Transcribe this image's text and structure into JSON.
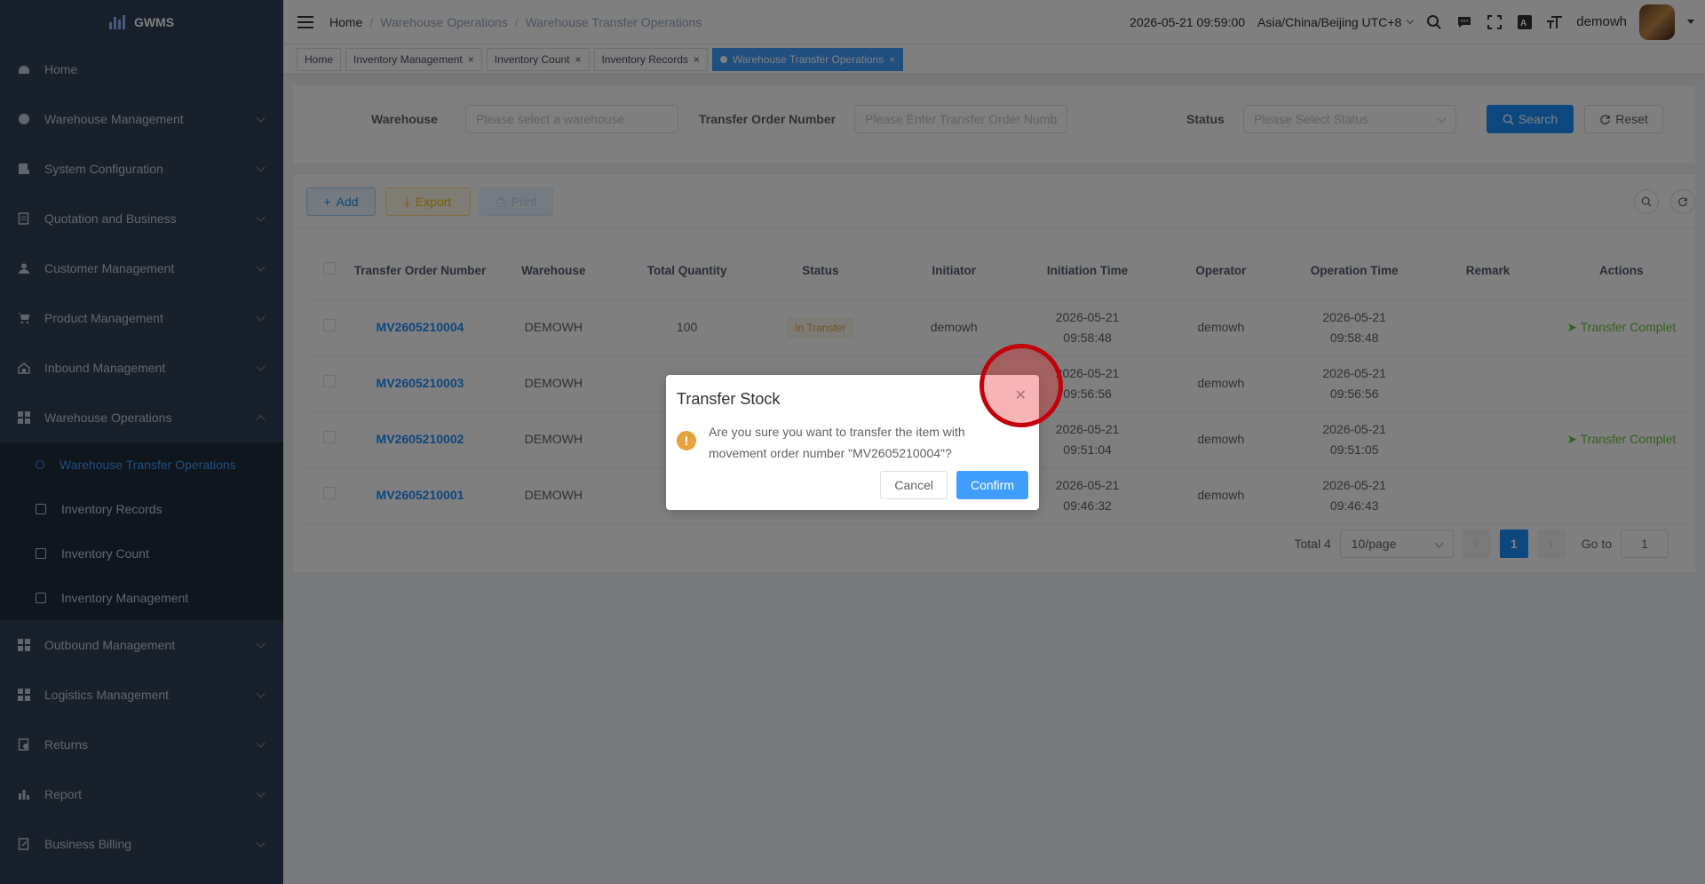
{
  "app": {
    "name": "GWMS"
  },
  "sidebar": {
    "items": [
      {
        "label": "Home",
        "icon": "dashboard-icon"
      },
      {
        "label": "Warehouse Management",
        "icon": "globe-icon"
      },
      {
        "label": "System Configuration",
        "icon": "config-icon"
      },
      {
        "label": "Quotation and Business",
        "icon": "document-icon"
      },
      {
        "label": "Customer Management",
        "icon": "user-icon"
      },
      {
        "label": "Product Management",
        "icon": "cart-icon"
      },
      {
        "label": "Inbound Management",
        "icon": "inbound-icon"
      },
      {
        "label": "Warehouse Operations",
        "icon": "grid-icon"
      }
    ],
    "sub_items": [
      {
        "label": "Warehouse Transfer Operations",
        "active": true
      },
      {
        "label": "Inventory Records"
      },
      {
        "label": "Inventory Count"
      },
      {
        "label": "Inventory Management"
      }
    ],
    "items_after": [
      {
        "label": "Outbound Management",
        "icon": "grid-icon"
      },
      {
        "label": "Logistics Management",
        "icon": "grid-icon"
      },
      {
        "label": "Returns",
        "icon": "returns-icon"
      },
      {
        "label": "Report",
        "icon": "chart-icon"
      },
      {
        "label": "Business Billing",
        "icon": "billing-icon"
      }
    ]
  },
  "navbar": {
    "breadcrumb": [
      "Home",
      "Warehouse Operations",
      "Warehouse Transfer Operations"
    ],
    "datetime": "2026-05-21 09:59:00",
    "timezone": "Asia/China/Beijing UTC+8",
    "username": "demowh"
  },
  "tags": [
    {
      "label": "Home"
    },
    {
      "label": "Inventory Management"
    },
    {
      "label": "Inventory Count"
    },
    {
      "label": "Inventory Records"
    },
    {
      "label": "Warehouse Transfer Operations",
      "active": true
    }
  ],
  "search": {
    "warehouse_label": "Warehouse",
    "warehouse_placeholder": "Please select a warehouse",
    "order_label": "Transfer Order Number",
    "order_placeholder": "Please Enter Transfer Order Numb",
    "status_label": "Status",
    "status_placeholder": "Please Select Status",
    "search_btn": "Search",
    "reset_btn": "Reset"
  },
  "toolbar": {
    "add": "Add",
    "export": "Export",
    "print": "Print"
  },
  "table": {
    "headers": [
      "Transfer Order Number",
      "Warehouse",
      "Total Quantity",
      "Status",
      "Initiator",
      "Initiation Time",
      "Operator",
      "Operation Time",
      "Remark",
      "Actions"
    ],
    "rows": [
      {
        "order": "MV2605210004",
        "warehouse": "DEMOWH",
        "qty": "100",
        "status": "In Transfer",
        "initiator": "demowh",
        "init_date": "2026-05-21",
        "init_time": "09:58:48",
        "operator": "demowh",
        "op_date": "2026-05-21",
        "op_time": "09:58:48",
        "remark": "",
        "action": "Transfer Complet"
      },
      {
        "order": "MV2605210003",
        "warehouse": "DEMOWH",
        "qty": "",
        "status": "",
        "initiator": "",
        "init_date": "2026-05-21",
        "init_time": "09:56:56",
        "operator": "demowh",
        "op_date": "2026-05-21",
        "op_time": "09:56:56",
        "remark": "",
        "action": ""
      },
      {
        "order": "MV2605210002",
        "warehouse": "DEMOWH",
        "qty": "",
        "status": "",
        "initiator": "",
        "init_date": "2026-05-21",
        "init_time": "09:51:04",
        "operator": "demowh",
        "op_date": "2026-05-21",
        "op_time": "09:51:05",
        "remark": "",
        "action": "Transfer Complet"
      },
      {
        "order": "MV2605210001",
        "warehouse": "DEMOWH",
        "qty": "",
        "status": "",
        "initiator": "",
        "init_date": "2026-05-21",
        "init_time": "09:46:32",
        "operator": "demowh",
        "op_date": "2026-05-21",
        "op_time": "09:46:43",
        "remark": "",
        "action": ""
      }
    ]
  },
  "pagination": {
    "total": "Total 4",
    "page_size": "10/page",
    "current": "1",
    "goto_label": "Go to",
    "goto_value": "1"
  },
  "dialog": {
    "title": "Transfer Stock",
    "message": "Are you sure you want to transfer the item with movement order number \"MV2605210004\"?",
    "cancel": "Cancel",
    "confirm": "Confirm"
  }
}
